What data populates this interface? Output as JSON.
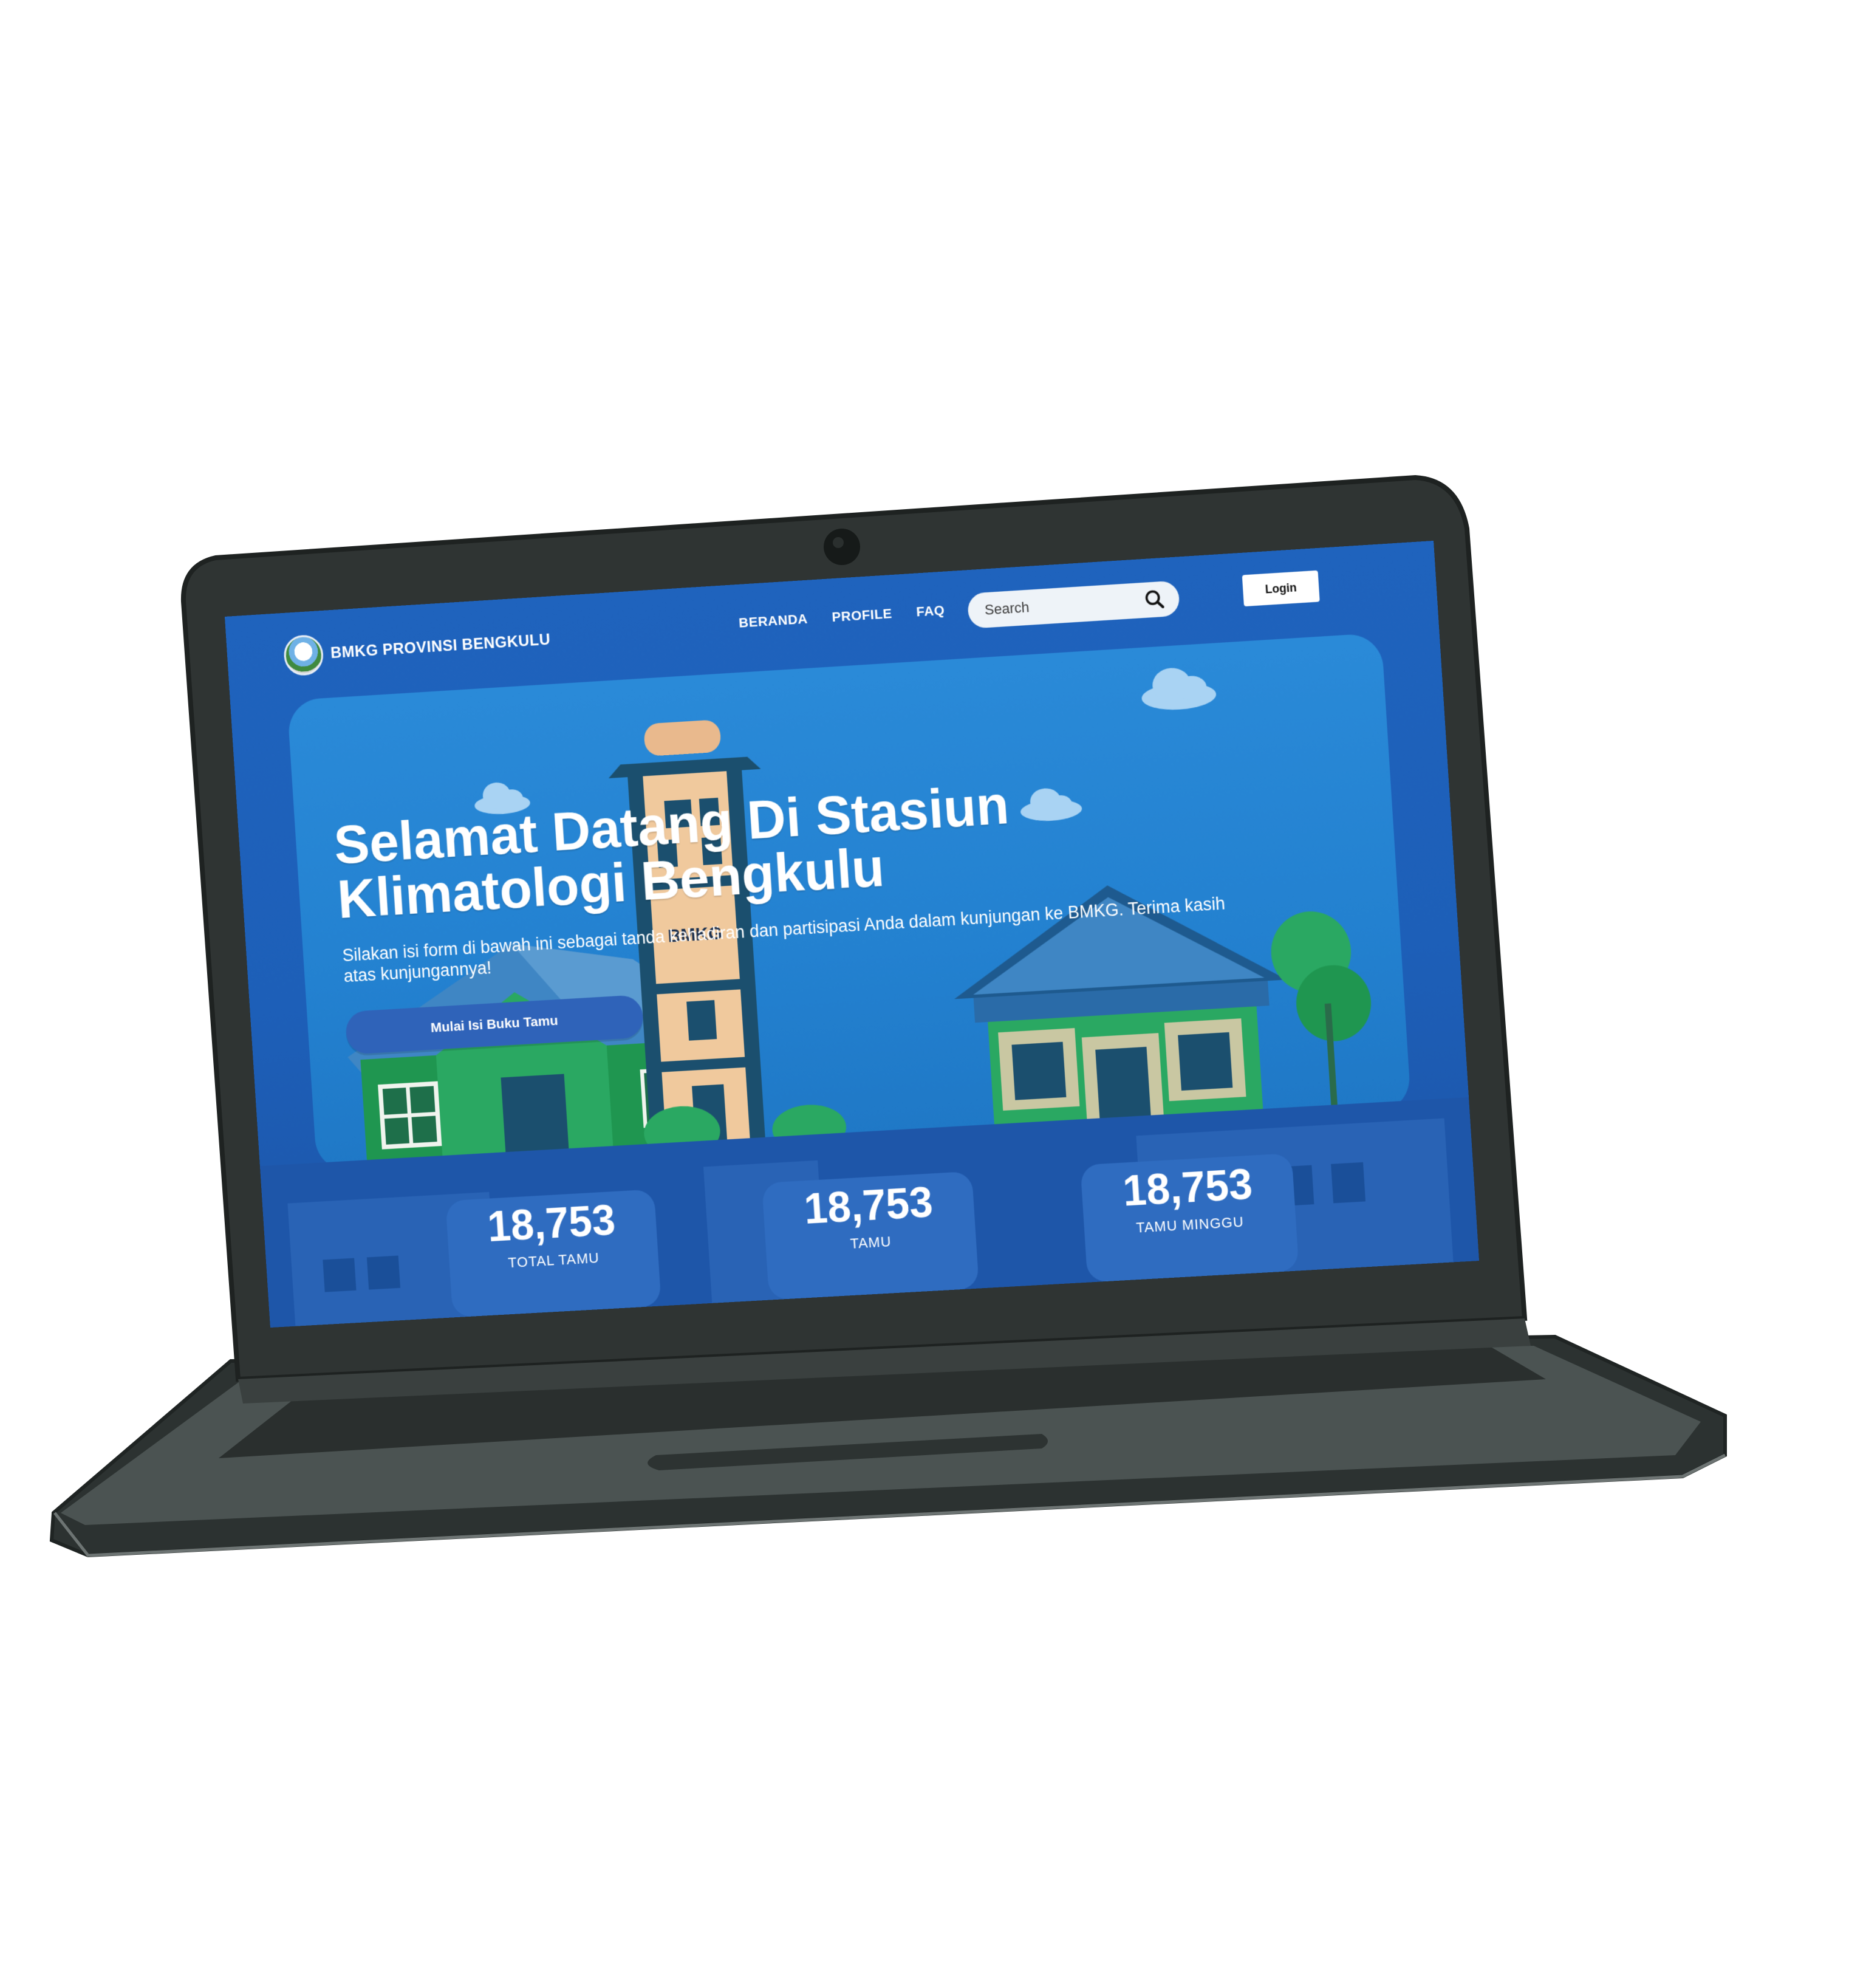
{
  "nav": {
    "brand": "BMKG PROVINSI BENGKULU",
    "menu": [
      {
        "label": "BERANDA"
      },
      {
        "label": "PROFILE"
      },
      {
        "label": "FAQ"
      }
    ],
    "search_placeholder": "Search",
    "login_label": "Login"
  },
  "hero": {
    "title": "Selamat Datang Di Stasiun Klimatologi Bengkulu",
    "subtitle": "Silakan isi form di bawah ini sebagai tanda kehadiran dan partisipasi Anda dalam kunjungan ke BMKG. Terima kasih atas kunjungannya!",
    "cta_label": "Mulai Isi Buku Tamu",
    "tower_sign": "BMKG"
  },
  "stats": [
    {
      "value": "18,753",
      "label": "TOTAL TAMU"
    },
    {
      "value": "18,753",
      "label": "TAMU"
    },
    {
      "value": "18,753",
      "label": "TAMU MINGGU"
    }
  ],
  "colors": {
    "page_blue": "#1f63bd",
    "hero_blue": "#2381d0",
    "button_blue": "#2f63b9",
    "laptop_body": "#2f3433",
    "laptop_deck": "#4b5352"
  }
}
